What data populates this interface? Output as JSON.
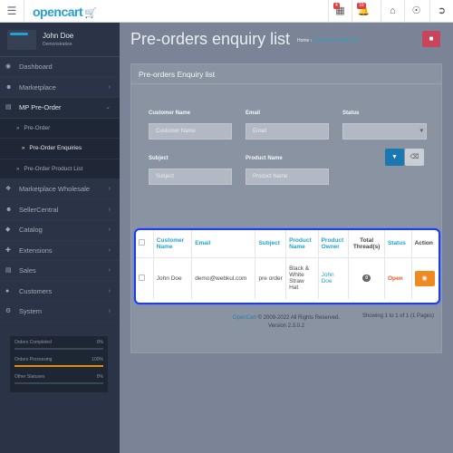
{
  "header": {
    "menu_icon": "hamburger-icon",
    "logo": "opencart",
    "logo_icon": "cart-icon",
    "badge_1": "4",
    "badge_2": "10"
  },
  "sidebar": {
    "user_name": "John Doe",
    "user_role": "Demonstration",
    "items": [
      {
        "label": "Dashboard",
        "icon": "dashboard-icon"
      },
      {
        "label": "Marketplace",
        "icon": "users-icon"
      },
      {
        "label": "MP Pre-Order",
        "icon": "cart-icon"
      },
      {
        "label": "Pre-Order"
      },
      {
        "label": "Pre-Order Enquiries"
      },
      {
        "label": "Pre-Order Product List"
      },
      {
        "label": "Marketplace Wholesale",
        "icon": "cubes-icon"
      },
      {
        "label": "SellerCentral",
        "icon": "users-icon"
      },
      {
        "label": "Catalog",
        "icon": "tag-icon"
      },
      {
        "label": "Extensions",
        "icon": "puzzle-icon"
      },
      {
        "label": "Sales",
        "icon": "cart-icon"
      },
      {
        "label": "Customers",
        "icon": "user-icon"
      },
      {
        "label": "System",
        "icon": "gear-icon"
      }
    ],
    "stats": [
      {
        "label": "Orders Completed",
        "value": "0%",
        "fraction": 0
      },
      {
        "label": "Orders Processing",
        "value": "100%",
        "fraction": 1
      },
      {
        "label": "Other Statuses",
        "value": "0%",
        "fraction": 0
      }
    ]
  },
  "main": {
    "title": "Pre-orders enquiry list",
    "breadcrumb_home": "Home",
    "breadcrumb_sep": "›",
    "breadcrumb_current": "Pre-orders enquiry list",
    "panel_title": "Pre-orders Enquiry list",
    "filters": {
      "customer_name_label": "Customer Name",
      "customer_name_placeholder": "Customer Name",
      "email_label": "Email",
      "email_placeholder": "Email",
      "status_label": "Status",
      "subject_label": "Subject",
      "subject_placeholder": "Subject",
      "product_name_label": "Product Name",
      "product_name_placeholder": "Product Name"
    },
    "table": {
      "headers": [
        "Customer Name",
        "Email",
        "Subject",
        "Product Name",
        "Product Owner",
        "Total Thread(s)",
        "Status",
        "Action"
      ],
      "rows": [
        {
          "customer": "John Doe",
          "email": "demo@webkul.com",
          "subject": "pre order",
          "product": "Black & White Straw Hat",
          "owner": "John Doe",
          "threads": "0",
          "status": "Open"
        }
      ]
    },
    "showing": "Showing 1 to 1 of 1 (1 Pages)",
    "footer_brand": "OpenCart",
    "footer_rights": "© 2009-2022 All Rights Reserved.",
    "footer_version": "Version 2.3.0.2"
  },
  "colors": {
    "accent": "#23a1d1",
    "status_open": "#e7562a",
    "highlight": "#1f3fd8",
    "action": "#ef8a22"
  }
}
